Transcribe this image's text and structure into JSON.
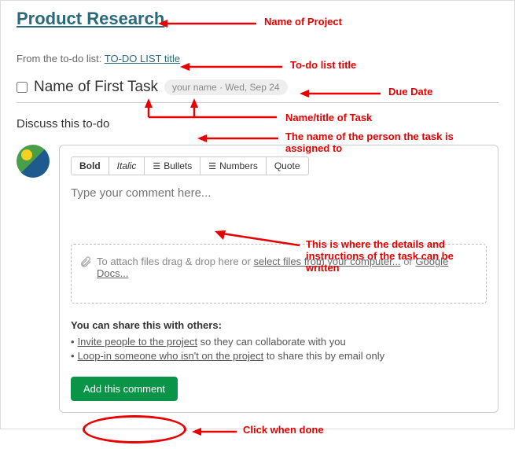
{
  "project": {
    "title": "Product Research"
  },
  "breadcrumb": {
    "prefix": "From the to-do list: ",
    "link": "TO-DO LIST title"
  },
  "task": {
    "name": "Name of First Task",
    "assignee": "your name",
    "due": "Wed, Sep 24"
  },
  "discuss_label": "Discuss this to-do",
  "toolbar": {
    "bold": "Bold",
    "italic": "Italic",
    "bullets": "Bullets",
    "numbers": "Numbers",
    "quote": "Quote"
  },
  "comment": {
    "placeholder": "Type your comment here..."
  },
  "attach": {
    "prefix": "To attach files drag & drop here or ",
    "link1": "select files from your computer...",
    "or": " or ",
    "link2": "Google Docs..."
  },
  "share": {
    "title": "You can share this with others:",
    "item1_link": "Invite people to the project",
    "item1_rest": " so they can collaborate with you",
    "item2_link": "Loop-in someone who isn't on the project",
    "item2_rest": " to share this by email only"
  },
  "button": {
    "add": "Add this comment"
  },
  "annotations": {
    "project": "Name of Project",
    "todo_list": "To-do list title",
    "due_date": "Due Date",
    "task_title": "Name/title of Task",
    "assignee": "The name of the person the task is assigned to",
    "comment_desc": "This is where the details and instructions of the task can be written",
    "click_done": "Click when done"
  }
}
